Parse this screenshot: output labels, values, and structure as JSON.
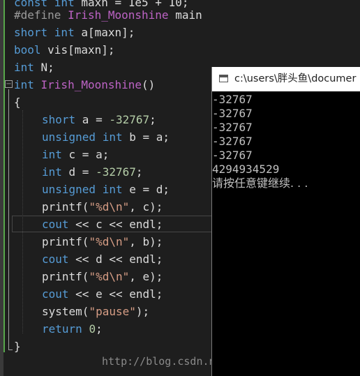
{
  "editor": {
    "lines": {
      "l0": {
        "a": "const int ",
        "b": "maxn",
        "c": " = 1e5 + 10;"
      },
      "l1": {
        "a": "#define ",
        "b": "Irish_Moonshine",
        "c": " main"
      },
      "l2": {
        "a": "short ",
        "b": "int ",
        "c": "a[maxn];"
      },
      "l3": {
        "a": "bool ",
        "b": "vis[maxn];"
      },
      "l4": {
        "a": "int ",
        "b": "N;"
      },
      "l5": {
        "a": "int ",
        "b": "Irish_Moonshine",
        "c": "()"
      },
      "l6": {
        "a": "{"
      },
      "l7": {
        "a": "short ",
        "b": "a",
        " c": "",
        "c": " = ",
        "d": "-32767",
        "e": ";"
      },
      "l8": {
        "a": "unsigned ",
        "b": "int ",
        "c": "b = a;"
      },
      "l9": {
        "a": "int ",
        "b": "c = a;"
      },
      "l10": {
        "a": "int ",
        "b": "d = ",
        "c": "-32767",
        "d": ";"
      },
      "l11": {
        "a": "unsigned ",
        "b": "int ",
        "c": "e = d;"
      },
      "l12": {
        "a": "printf",
        "b": "(",
        "c": "\"%d\\n\"",
        "d": ", c);"
      },
      "l13": {
        "a": "cout ",
        "b": "<< c << endl;"
      },
      "l14": {
        "a": "printf",
        "b": "(",
        "c": "\"%d\\n\"",
        "d": ", b);"
      },
      "l15": {
        "a": "cout ",
        "b": "<< d << endl;"
      },
      "l16": {
        "a": "printf",
        "b": "(",
        "c": "\"%d\\n\"",
        "d": ", e);"
      },
      "l17": {
        "a": "cout ",
        "b": "<< e << endl;"
      },
      "l18": {
        "a": "system",
        "b": "(",
        "c": "\"pause\"",
        "d": ");"
      },
      "l19": {
        "a": "return ",
        "b": "0",
        "c": ";"
      },
      "l20": {
        "a": "}"
      }
    },
    "collapse_symbol": "−"
  },
  "console": {
    "title": "c:\\users\\胖头鱼\\documer",
    "output": [
      "-32767",
      "-32767",
      "-32767",
      "-32767",
      "-32767",
      "4294934529",
      "请按任意键继续. . ."
    ]
  },
  "watermark": "http://blog.csdn.net/Irish_Moonshine"
}
